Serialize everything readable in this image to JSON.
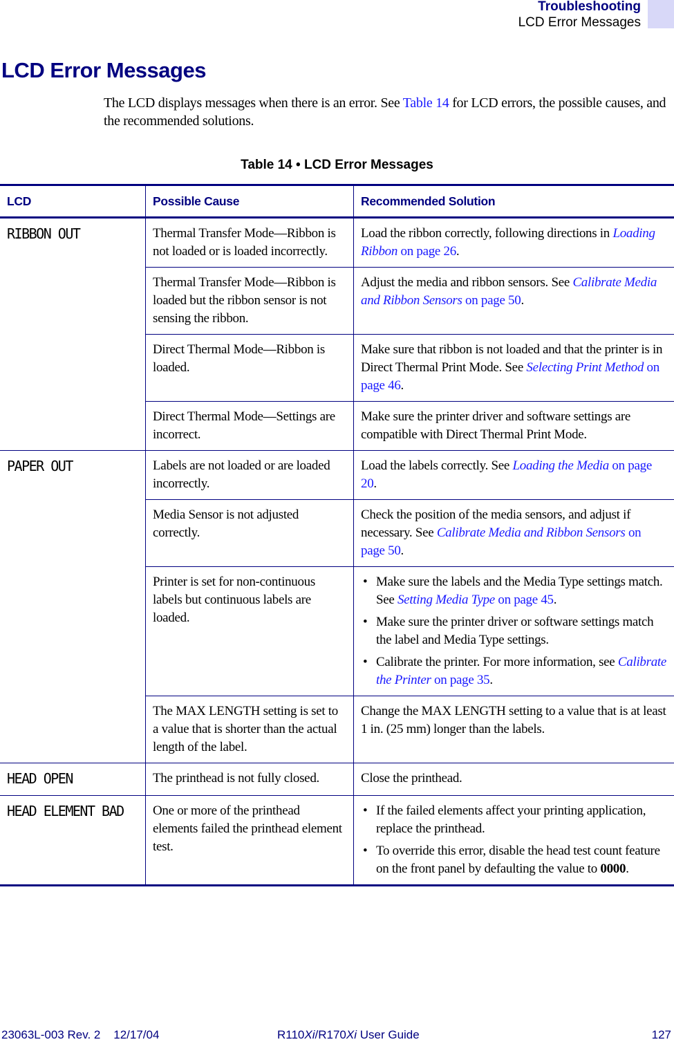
{
  "header": {
    "section": "Troubleshooting",
    "subsection": "LCD Error Messages"
  },
  "page_title": "LCD Error Messages",
  "intro": {
    "before": "The LCD displays messages when there is an error. See ",
    "link": "Table 14",
    "after": " for LCD errors, the possible causes, and the recommended solutions."
  },
  "table": {
    "caption": "Table 14 • LCD Error Messages",
    "headers": [
      "LCD",
      "Possible Cause",
      "Recommended Solution"
    ],
    "groups": [
      {
        "lcd": "RIBBON OUT",
        "rows": [
          {
            "cause": "Thermal Transfer Mode—Ribbon is not loaded or is loaded incorrectly.",
            "solution": {
              "text": "Load the ribbon correctly, following directions in ",
              "link": "Loading Ribbon",
              "link_tail": " on page 26",
              "end": "."
            }
          },
          {
            "cause": "Thermal Transfer Mode—Ribbon is loaded but the ribbon sensor is not sensing the ribbon.",
            "solution": {
              "text": "Adjust the media and ribbon sensors. See ",
              "link": "Calibrate Media and Ribbon Sensors",
              "link_tail": " on page 50",
              "end": "."
            }
          },
          {
            "cause": "Direct Thermal Mode—Ribbon is loaded.",
            "solution": {
              "text": "Make sure that ribbon is not loaded and that the printer is in Direct Thermal Print Mode. See ",
              "link": "Selecting Print Method",
              "link_tail": " on page 46",
              "end": "."
            }
          },
          {
            "cause": "Direct Thermal Mode—Settings are incorrect.",
            "solution": {
              "text": "Make sure the printer driver and software settings are compatible with Direct Thermal Print Mode."
            }
          }
        ]
      },
      {
        "lcd": "PAPER OUT",
        "rows": [
          {
            "cause": "Labels are not loaded or are loaded incorrectly.",
            "solution": {
              "text": "Load the labels correctly. See ",
              "link": "Loading the Media",
              "link_tail": " on page 20",
              "end": "."
            }
          },
          {
            "cause": "Media Sensor is not adjusted correctly.",
            "solution": {
              "text": "Check the position of the media sensors, and adjust if necessary. See ",
              "link": "Calibrate Media and Ribbon Sensors",
              "link_tail": " on page 50",
              "end": "."
            }
          },
          {
            "cause": "Printer is set for non-continuous labels but continuous labels are loaded.",
            "bullets": [
              {
                "text": "Make sure the labels and the Media Type settings match. See ",
                "link": "Setting Media Type",
                "link_tail": " on page 45",
                "end": "."
              },
              {
                "text": "Make sure the printer driver or software settings match the label and Media Type settings."
              },
              {
                "text": "Calibrate the printer. For more information, see ",
                "link": "Calibrate the Printer",
                "link_tail": " on page 35",
                "end": "."
              }
            ]
          },
          {
            "cause": "The MAX LENGTH setting is set to a value that is shorter than the actual length of the label.",
            "solution": {
              "text": "Change the MAX LENGTH setting to a value that is at least 1 in. (25 mm) longer than the labels."
            }
          }
        ]
      },
      {
        "lcd": "HEAD OPEN",
        "rows": [
          {
            "cause": "The printhead is not fully closed.",
            "solution": {
              "text": "Close the printhead."
            }
          }
        ]
      },
      {
        "lcd": "HEAD ELEMENT BAD",
        "rows": [
          {
            "cause": "One or more of the printhead elements failed the printhead element test.",
            "bullets": [
              {
                "text": "If the failed elements affect your printing application, replace the printhead."
              },
              {
                "text": "To override this error, disable the head test count feature on the front panel by defaulting the value to ",
                "bold": "0000",
                "end": "."
              }
            ]
          }
        ]
      }
    ]
  },
  "footer": {
    "doc_id": "23063L-003 Rev. 2    12/17/04",
    "guide_prefix1": "R110",
    "guide_italic1": "Xi",
    "guide_sep": "/R170",
    "guide_italic2": "Xi",
    "guide_suffix": " User Guide",
    "page_number": "127"
  },
  "colors": {
    "brand_navy": "#000080",
    "link_blue": "#1a1aff",
    "header_block": "#d8d8f8"
  }
}
